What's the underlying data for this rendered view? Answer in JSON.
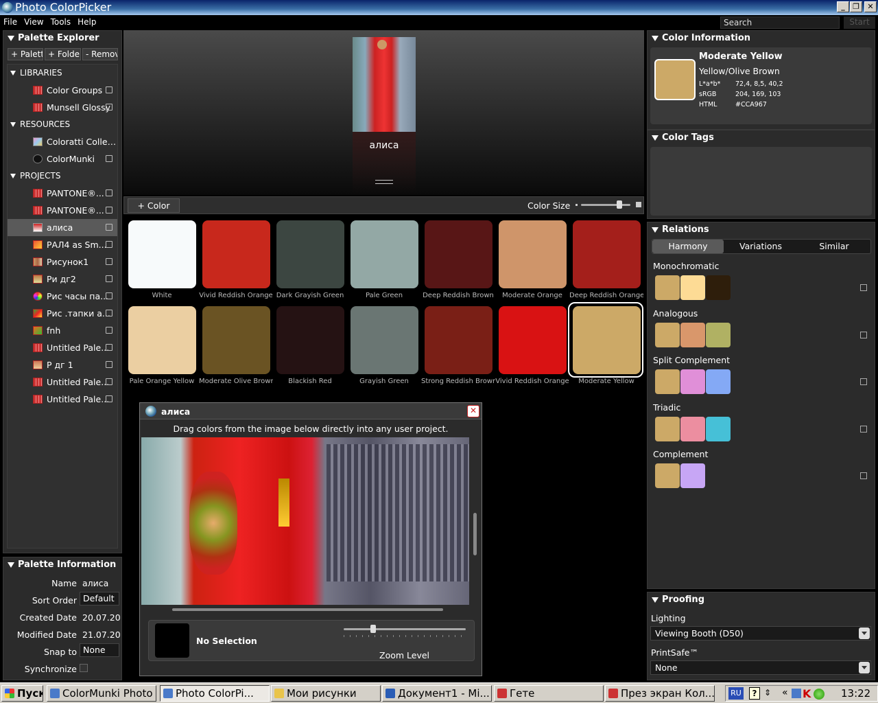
{
  "window": {
    "title": "Photo ColorPicker",
    "search_placeholder": "Search",
    "start_label": "Start"
  },
  "menu": [
    "File",
    "View",
    "Tools",
    "Help"
  ],
  "palette_explorer": {
    "title": "Palette Explorer",
    "buttons": [
      "+ Palett",
      "+ Folde",
      "- Remov"
    ],
    "sections": [
      {
        "label": "LIBRARIES",
        "items": [
          "Color Groups",
          "Munsell Glossy"
        ]
      },
      {
        "label": "RESOURCES",
        "items": [
          "Coloratti Collect...",
          "ColorMunki"
        ]
      },
      {
        "label": "PROJECTS",
        "items": [
          "PANTONE®...",
          "PANTONE®...",
          "алиса",
          "РАЛ4 as Sm...",
          "Рисунок1",
          "Ри дг2",
          "Рис часы па...",
          "Рис .тапки а...",
          "fnh",
          "Untitled Pale...",
          "Р дг 1",
          "Untitled Pale...",
          "Untitled Pale..."
        ]
      }
    ],
    "selected": "алиса"
  },
  "palette_info": {
    "title": "Palette Information",
    "name_label": "Name",
    "name_value": "алиса",
    "sort_label": "Sort Order",
    "sort_value": "Default",
    "created_label": "Created Date",
    "created_value": "20.07.20",
    "modified_label": "Modified Date",
    "modified_value": "21.07.20",
    "snap_label": "Snap to",
    "snap_value": "None",
    "sync_label": "Synchronize"
  },
  "preview": {
    "caption": "алиса"
  },
  "toolbar": {
    "add_color": "+ Color",
    "color_size": "Color Size",
    "color_size_level": 0.78
  },
  "swatches": [
    {
      "name": "White",
      "hex": "#F7FAFB"
    },
    {
      "name": "Vivid Reddish Orange",
      "hex": "#C8281C"
    },
    {
      "name": "Dark Grayish Green",
      "hex": "#3C4641"
    },
    {
      "name": "Pale Green",
      "hex": "#93A8A5"
    },
    {
      "name": "Deep Reddish Brown",
      "hex": "#581616"
    },
    {
      "name": "Moderate Orange",
      "hex": "#CF956A"
    },
    {
      "name": "Deep Reddish Orange",
      "hex": "#A41F1B"
    },
    {
      "name": "Pale Orange Yellow",
      "hex": "#EBCFA2"
    },
    {
      "name": "Moderate Olive Brown",
      "hex": "#6A5323"
    },
    {
      "name": "Blackish Red",
      "hex": "#251213"
    },
    {
      "name": "Grayish Green",
      "hex": "#6A7673"
    },
    {
      "name": "Strong Reddish Brown",
      "hex": "#7A1F16"
    },
    {
      "name": "Vivid Reddish Orange",
      "hex": "#D91213"
    },
    {
      "name": "Moderate Yellow",
      "hex": "#CCA967"
    }
  ],
  "image_window": {
    "title": "алиса",
    "hint": "Drag colors from the image below directly into any user project.",
    "selection": "No Selection",
    "zoom_label": "Zoom Level",
    "zoom_level": 0.24
  },
  "color_info": {
    "title": "Color Information",
    "name": "Moderate Yellow",
    "family": "Yellow/Olive Brown",
    "rows": [
      {
        "label": "L*a*b*",
        "value": "72,4, 8,5, 40,2"
      },
      {
        "label": "sRGB",
        "value": "204, 169, 103"
      },
      {
        "label": "HTML",
        "value": "#CCA967"
      }
    ],
    "hex": "#CCA967"
  },
  "color_tags": {
    "title": "Color Tags"
  },
  "relations": {
    "title": "Relations",
    "tabs": [
      "Harmony",
      "Variations",
      "Similar"
    ],
    "active_tab": "Harmony",
    "groups": [
      {
        "label": "Monochromatic",
        "colors": [
          "#CCA967",
          "#FDDB95",
          "#2E1E0B"
        ]
      },
      {
        "label": "Analogous",
        "colors": [
          "#CCA967",
          "#D9976B",
          "#B0B163"
        ]
      },
      {
        "label": "Split Complement",
        "colors": [
          "#CCA967",
          "#E08FD8",
          "#84A9F5"
        ]
      },
      {
        "label": "Triadic",
        "colors": [
          "#CCA967",
          "#EC8EA0",
          "#46C0D7"
        ]
      },
      {
        "label": "Complement",
        "colors": [
          "#CCA967",
          "#C7A6F5"
        ]
      }
    ]
  },
  "proofing": {
    "title": "Proofing",
    "lighting_label": "Lighting",
    "lighting_value": "Viewing Booth (D50)",
    "printsafe_label": "PrintSafe™",
    "printsafe_value": "None"
  },
  "taskbar": {
    "start": "Пуск",
    "items": [
      "ColorMunki Photo",
      "Photo ColorPi...",
      "Мои рисунки",
      "Документ1 - Mi...",
      "Гете",
      "През экран Кол..."
    ],
    "active_index": 1,
    "lang": "RU",
    "clock": "13:22"
  }
}
